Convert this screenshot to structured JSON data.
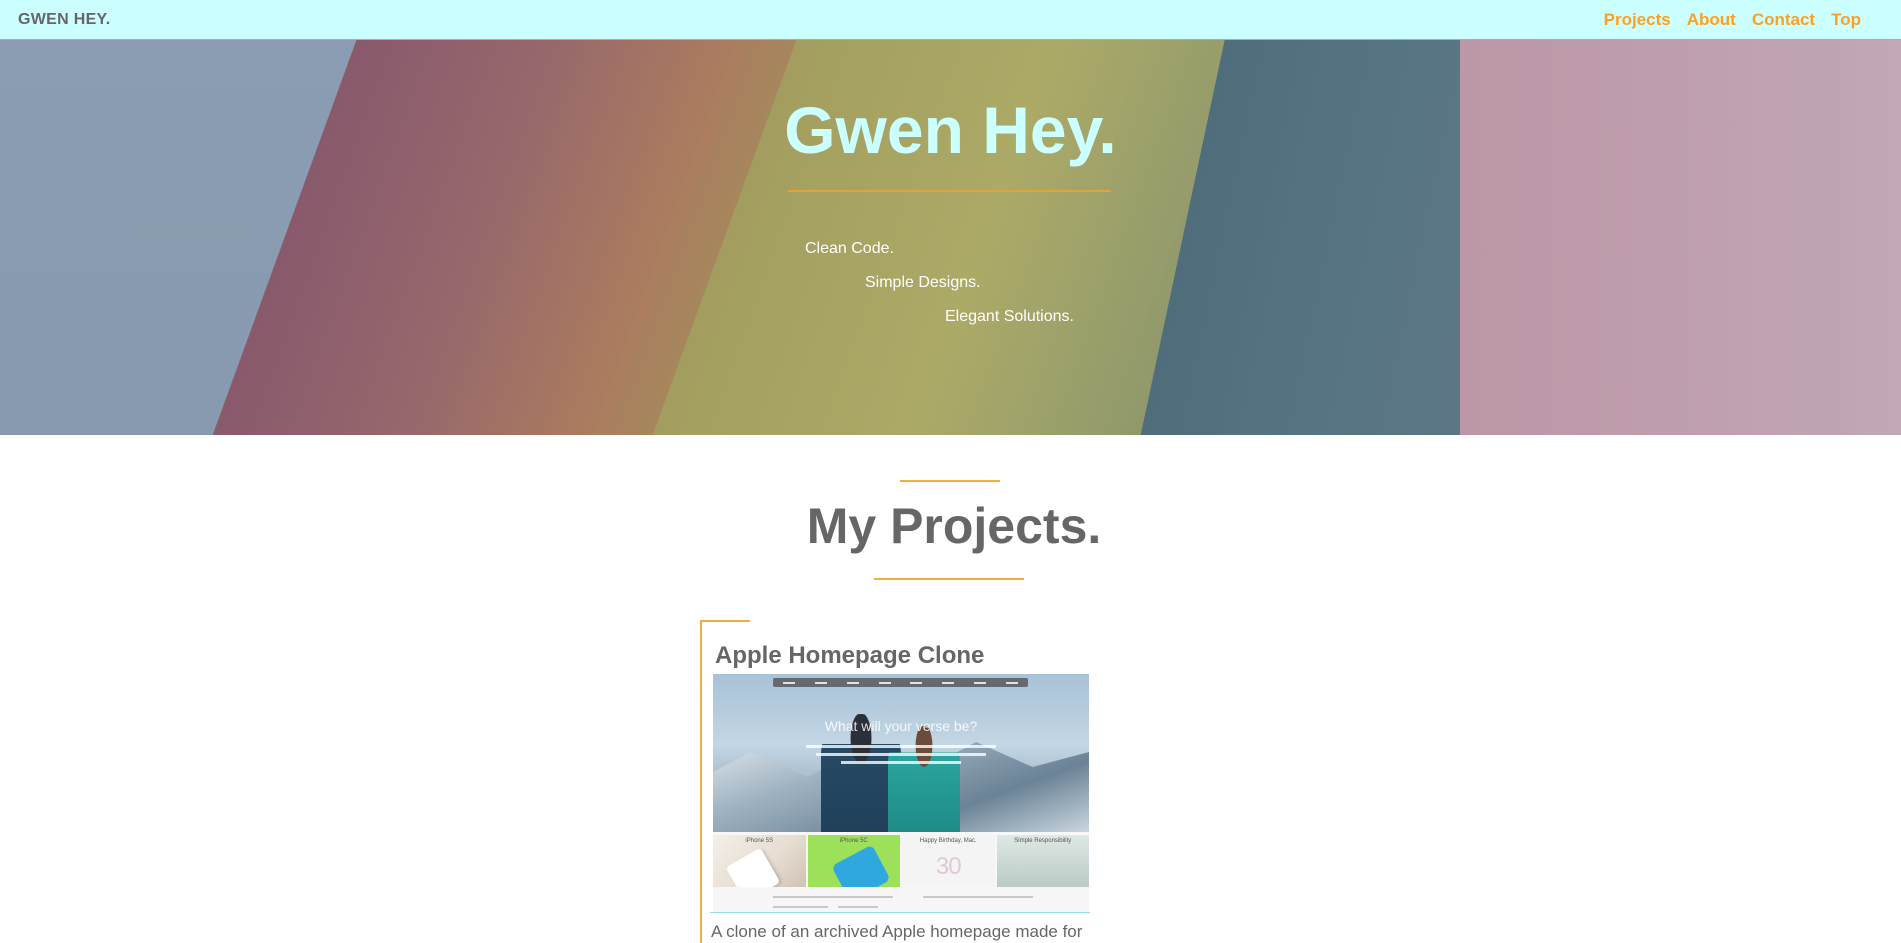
{
  "navbar": {
    "brand": "GWEN HEY.",
    "links": [
      "Projects",
      "About",
      "Contact",
      "Top"
    ]
  },
  "hero": {
    "title": "Gwen Hey.",
    "taglines": [
      "Clean Code.",
      "Simple Designs.",
      "Elegant Solutions."
    ]
  },
  "projects_section": {
    "title": "My Projects.",
    "cards": [
      {
        "title": "Apple Homepage Clone",
        "screenshot": {
          "headline": "What will your verse be?",
          "tiles": [
            "iPhone 5S",
            "iPhone 5C",
            "Happy Birthday, Mac.",
            "Simple Responsibility"
          ],
          "tile_number": "30"
        },
        "description": "A clone of an archived Apple homepage made for a"
      }
    ]
  },
  "colors": {
    "nav_bg": "#ccffff",
    "accent": "#ffa020",
    "text_gray": "#666666",
    "hero_title": "#ccffff"
  }
}
